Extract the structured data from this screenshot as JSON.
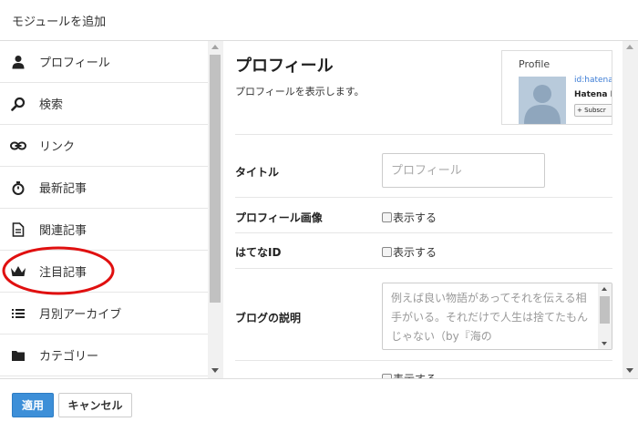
{
  "dialog": {
    "title": "モジュールを追加"
  },
  "sidebar": {
    "items": [
      {
        "label": "プロフィール",
        "icon": "user-icon"
      },
      {
        "label": "検索",
        "icon": "search-icon"
      },
      {
        "label": "リンク",
        "icon": "link-icon"
      },
      {
        "label": "最新記事",
        "icon": "stopwatch-icon"
      },
      {
        "label": "関連記事",
        "icon": "document-icon"
      },
      {
        "label": "注目記事",
        "icon": "crown-icon"
      },
      {
        "label": "月別アーカイブ",
        "icon": "list-icon"
      },
      {
        "label": "カテゴリー",
        "icon": "folder-icon"
      }
    ]
  },
  "main": {
    "title": "プロフィール",
    "description": "プロフィールを表示します。",
    "preview": {
      "title": "Profile",
      "id_text": "id:hatena",
      "name_text": "Hatena B",
      "subscribe_text": "+ Subscr"
    },
    "fields": {
      "title_label": "タイトル",
      "title_placeholder": "プロフィール",
      "image_label": "プロフィール画像",
      "image_checkbox_label": "表示する",
      "hatena_id_label": "はてなID",
      "hatena_id_checkbox_label": "表示する",
      "blog_desc_label": "ブログの説明",
      "blog_desc_placeholder": "例えば良い物語があってそれを伝える相手がいる。それだけで人生は捨てたもんじゃない（by『海の",
      "next_checkbox_label": "表示する"
    }
  },
  "footer": {
    "apply_label": "適用",
    "cancel_label": "キャンセル"
  },
  "colors": {
    "apply_button": "#3d8fd8",
    "highlight_circle": "#e01010",
    "link": "#3a7bd5"
  }
}
